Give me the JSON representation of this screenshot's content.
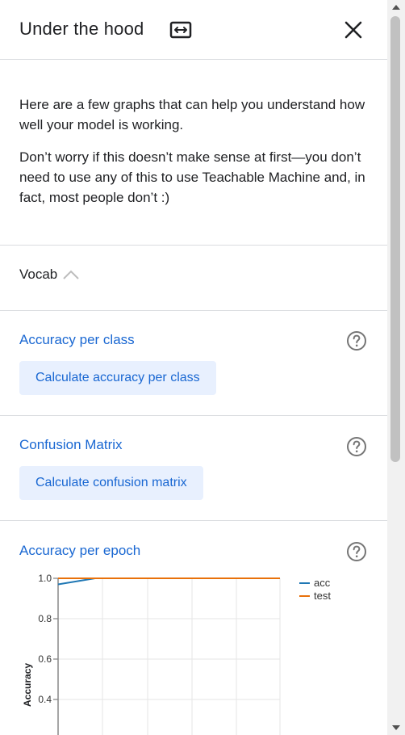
{
  "header": {
    "title": "Under the hood",
    "expand_icon": "expand-horizontal-icon",
    "close_icon": "close-icon"
  },
  "intro": {
    "paragraph1": "Here are a few graphs that can help you understand how well your model is working.",
    "paragraph2": "Don’t worry if this doesn’t make sense at first—you don’t need to use any of this to use Teachable Machine and, in fact, most people don’t :)"
  },
  "vocab": {
    "label": "Vocab",
    "icon": "chevron-up-icon"
  },
  "sections": {
    "accuracy_per_class": {
      "title": "Accuracy per class",
      "button": "Calculate accuracy per class",
      "help_icon": "help-circle-icon"
    },
    "confusion_matrix": {
      "title": "Confusion Matrix",
      "button": "Calculate confusion matrix",
      "help_icon": "help-circle-icon"
    },
    "accuracy_per_epoch": {
      "title": "Accuracy per epoch",
      "help_icon": "help-circle-icon"
    }
  },
  "colors": {
    "accent": "#1967d2",
    "button_bg": "#e8f0fe",
    "acc_series": "#1f77b4",
    "test_series": "#e8710a"
  },
  "chart_data": {
    "type": "line",
    "ylabel": "Accuracy",
    "xlabel": "",
    "y_ticks": [
      "1.0",
      "0.8",
      "0.6",
      "0.4"
    ],
    "ylim": [
      0.3,
      1.0
    ],
    "grid": true,
    "legend_placement": "top-right",
    "series": [
      {
        "name": "acc",
        "color": "#1f77b4",
        "values": [
          0.97,
          1.0,
          1.0,
          1.0,
          1.0,
          1.0,
          1.0
        ]
      },
      {
        "name": "test",
        "color": "#e8710a",
        "values": [
          1.0,
          1.0,
          1.0,
          1.0,
          1.0,
          1.0,
          1.0
        ]
      }
    ]
  }
}
